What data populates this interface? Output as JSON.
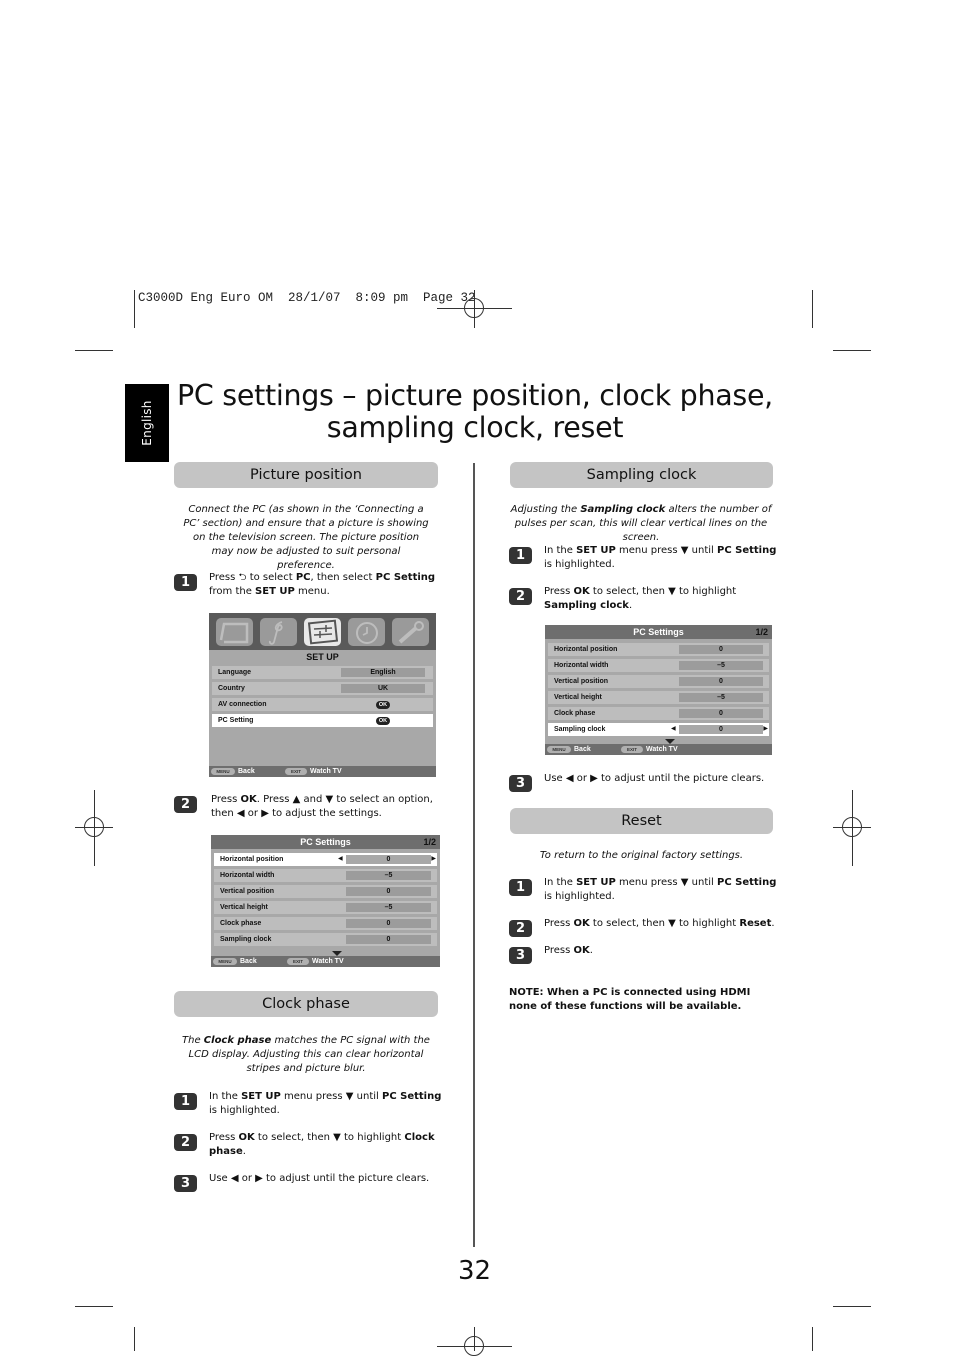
{
  "slug": "C3000D Eng Euro OM  28/1/07  8:09 pm  Page 32",
  "language_tab": "English",
  "title": {
    "line1": "PC settings – picture position, clock phase,",
    "line2": "sampling clock, reset"
  },
  "picture_position": {
    "heading": "Picture position",
    "intro": "Connect the PC (as shown in the ‘Connecting a PC’ section) and ensure that a picture is showing on the television screen. The picture position may now be adjusted to suit personal preference.",
    "steps": [
      {
        "num": "1",
        "parts": [
          [
            "Press ",
            false
          ],
          [
            "⮌",
            false
          ],
          [
            " to select ",
            false
          ],
          [
            "PC",
            true
          ],
          [
            ", then select ",
            false
          ],
          [
            "PC Setting",
            true
          ],
          [
            " from the ",
            false
          ],
          [
            "SET UP",
            true
          ],
          [
            " menu.",
            false
          ]
        ]
      },
      {
        "num": "2",
        "parts": [
          [
            "Press ",
            false
          ],
          [
            "OK",
            true
          ],
          [
            ". Press ▲ and ▼ to select an option, then ◀ or ▶ to adjust the settings.",
            false
          ]
        ]
      }
    ]
  },
  "setup_menu": {
    "icons": [
      "picture-icon",
      "sound-icon",
      "setup-icon",
      "timer-icon",
      "feature-icon"
    ],
    "title": "SET UP",
    "rows": [
      {
        "label": "Language",
        "value": "English",
        "type": "value"
      },
      {
        "label": "Country",
        "value": "UK",
        "type": "value"
      },
      {
        "label": "AV connection",
        "value": "OK",
        "type": "ok"
      },
      {
        "label": "PC Setting",
        "value": "OK",
        "type": "ok",
        "selected": true
      }
    ],
    "footer": {
      "menu_key": "MENU",
      "back": "Back",
      "exit_key": "EXIT",
      "watch": "Watch TV"
    }
  },
  "pc_settings_menu_1": {
    "title": "PC Settings",
    "page": "1/2",
    "rows": [
      {
        "label": "Horizontal position",
        "value": "0",
        "selected": true
      },
      {
        "label": "Horizontal width",
        "value": "–5"
      },
      {
        "label": "Vertical position",
        "value": "0"
      },
      {
        "label": "Vertical height",
        "value": "–5"
      },
      {
        "label": "Clock phase",
        "value": "0"
      },
      {
        "label": "Sampling clock",
        "value": "0"
      }
    ],
    "footer": {
      "menu_key": "MENU",
      "back": "Back",
      "exit_key": "EXIT",
      "watch": "Watch TV"
    }
  },
  "clock_phase": {
    "heading": "Clock phase",
    "intro_parts": [
      [
        "The ",
        false
      ],
      [
        "Clock phase",
        true
      ],
      [
        " matches the PC signal with the LCD display. Adjusting this can clear horizontal stripes and picture blur.",
        false
      ]
    ],
    "steps": [
      {
        "num": "1",
        "parts": [
          [
            "In the ",
            false
          ],
          [
            "SET UP",
            true
          ],
          [
            " menu press ▼ until ",
            false
          ],
          [
            "PC Setting",
            true
          ],
          [
            " is highlighted.",
            false
          ]
        ]
      },
      {
        "num": "2",
        "parts": [
          [
            "Press ",
            false
          ],
          [
            "OK",
            true
          ],
          [
            " to select, then ▼ to highlight ",
            false
          ],
          [
            "Clock phase",
            true
          ],
          [
            ".",
            false
          ]
        ]
      },
      {
        "num": "3",
        "parts": [
          [
            "Use ◀ or ▶ to adjust until the picture clears.",
            false
          ]
        ]
      }
    ]
  },
  "sampling_clock": {
    "heading": "Sampling clock",
    "intro_parts": [
      [
        "Adjusting the ",
        false
      ],
      [
        "Sampling clock",
        true
      ],
      [
        " alters the number of pulses per scan, this will clear vertical lines on the screen.",
        false
      ]
    ],
    "steps": [
      {
        "num": "1",
        "parts": [
          [
            "In the ",
            false
          ],
          [
            "SET UP",
            true
          ],
          [
            " menu press ▼ until ",
            false
          ],
          [
            "PC Setting",
            true
          ],
          [
            " is highlighted.",
            false
          ]
        ]
      },
      {
        "num": "2",
        "parts": [
          [
            "Press ",
            false
          ],
          [
            "OK",
            true
          ],
          [
            " to select, then ▼ to highlight ",
            false
          ],
          [
            "Sampling clock",
            true
          ],
          [
            ".",
            false
          ]
        ]
      },
      {
        "num": "3",
        "parts": [
          [
            "Use ◀ or ▶ to adjust until the picture clears.",
            false
          ]
        ]
      }
    ]
  },
  "pc_settings_menu_2": {
    "title": "PC Settings",
    "page": "1/2",
    "rows": [
      {
        "label": "Horizontal position",
        "value": "0"
      },
      {
        "label": "Horizontal width",
        "value": "–5"
      },
      {
        "label": "Vertical position",
        "value": "0"
      },
      {
        "label": "Vertical height",
        "value": "–5"
      },
      {
        "label": "Clock phase",
        "value": "0"
      },
      {
        "label": "Sampling clock",
        "value": "0",
        "selected": true
      }
    ],
    "footer": {
      "menu_key": "MENU",
      "back": "Back",
      "exit_key": "EXIT",
      "watch": "Watch TV"
    }
  },
  "reset": {
    "heading": "Reset",
    "intro": "To return to the original factory settings.",
    "steps": [
      {
        "num": "1",
        "parts": [
          [
            "In the ",
            false
          ],
          [
            "SET UP",
            true
          ],
          [
            " menu press ▼ until ",
            false
          ],
          [
            "PC Setting",
            true
          ],
          [
            " is highlighted.",
            false
          ]
        ]
      },
      {
        "num": "2",
        "parts": [
          [
            "Press ",
            false
          ],
          [
            "OK",
            true
          ],
          [
            " to select, then ▼ to highlight ",
            false
          ],
          [
            "Reset",
            true
          ],
          [
            ".",
            false
          ]
        ]
      },
      {
        "num": "3",
        "parts": [
          [
            "Press ",
            false
          ],
          [
            "OK",
            true
          ],
          [
            ".",
            false
          ]
        ]
      }
    ]
  },
  "note": "NOTE: When a PC is connected using HDMI none of these functions will be available.",
  "page_number": "32"
}
